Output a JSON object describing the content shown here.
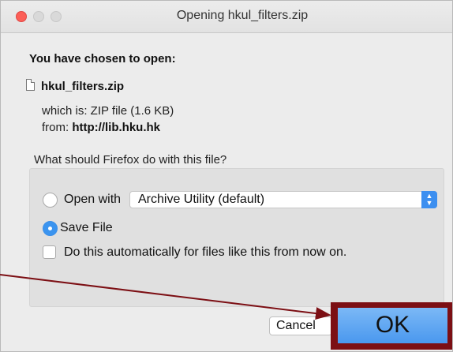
{
  "window": {
    "title": "Opening hkul_filters.zip"
  },
  "dialog": {
    "heading": "You have chosen to open:",
    "file_name": "hkul_filters.zip",
    "file_icon": "document-icon",
    "which_is": "which is:  ZIP file (1.6 KB)",
    "from_label": "from:",
    "from_url": "http://lib.hku.hk",
    "question": "What should Firefox do with this file?"
  },
  "options": {
    "open_with_label": "Open with",
    "open_with_checked": false,
    "app_select_value": "Archive Utility (default)",
    "save_file_label": "Save File",
    "save_file_checked": true,
    "auto_label": "Do this automatically for files like this from now on.",
    "auto_checked": false
  },
  "buttons": {
    "cancel_label": "Cancel",
    "ok_label": "OK"
  },
  "annotation": {
    "highlight_color": "#7c0f14",
    "arrow_color": "#7c0f14"
  }
}
